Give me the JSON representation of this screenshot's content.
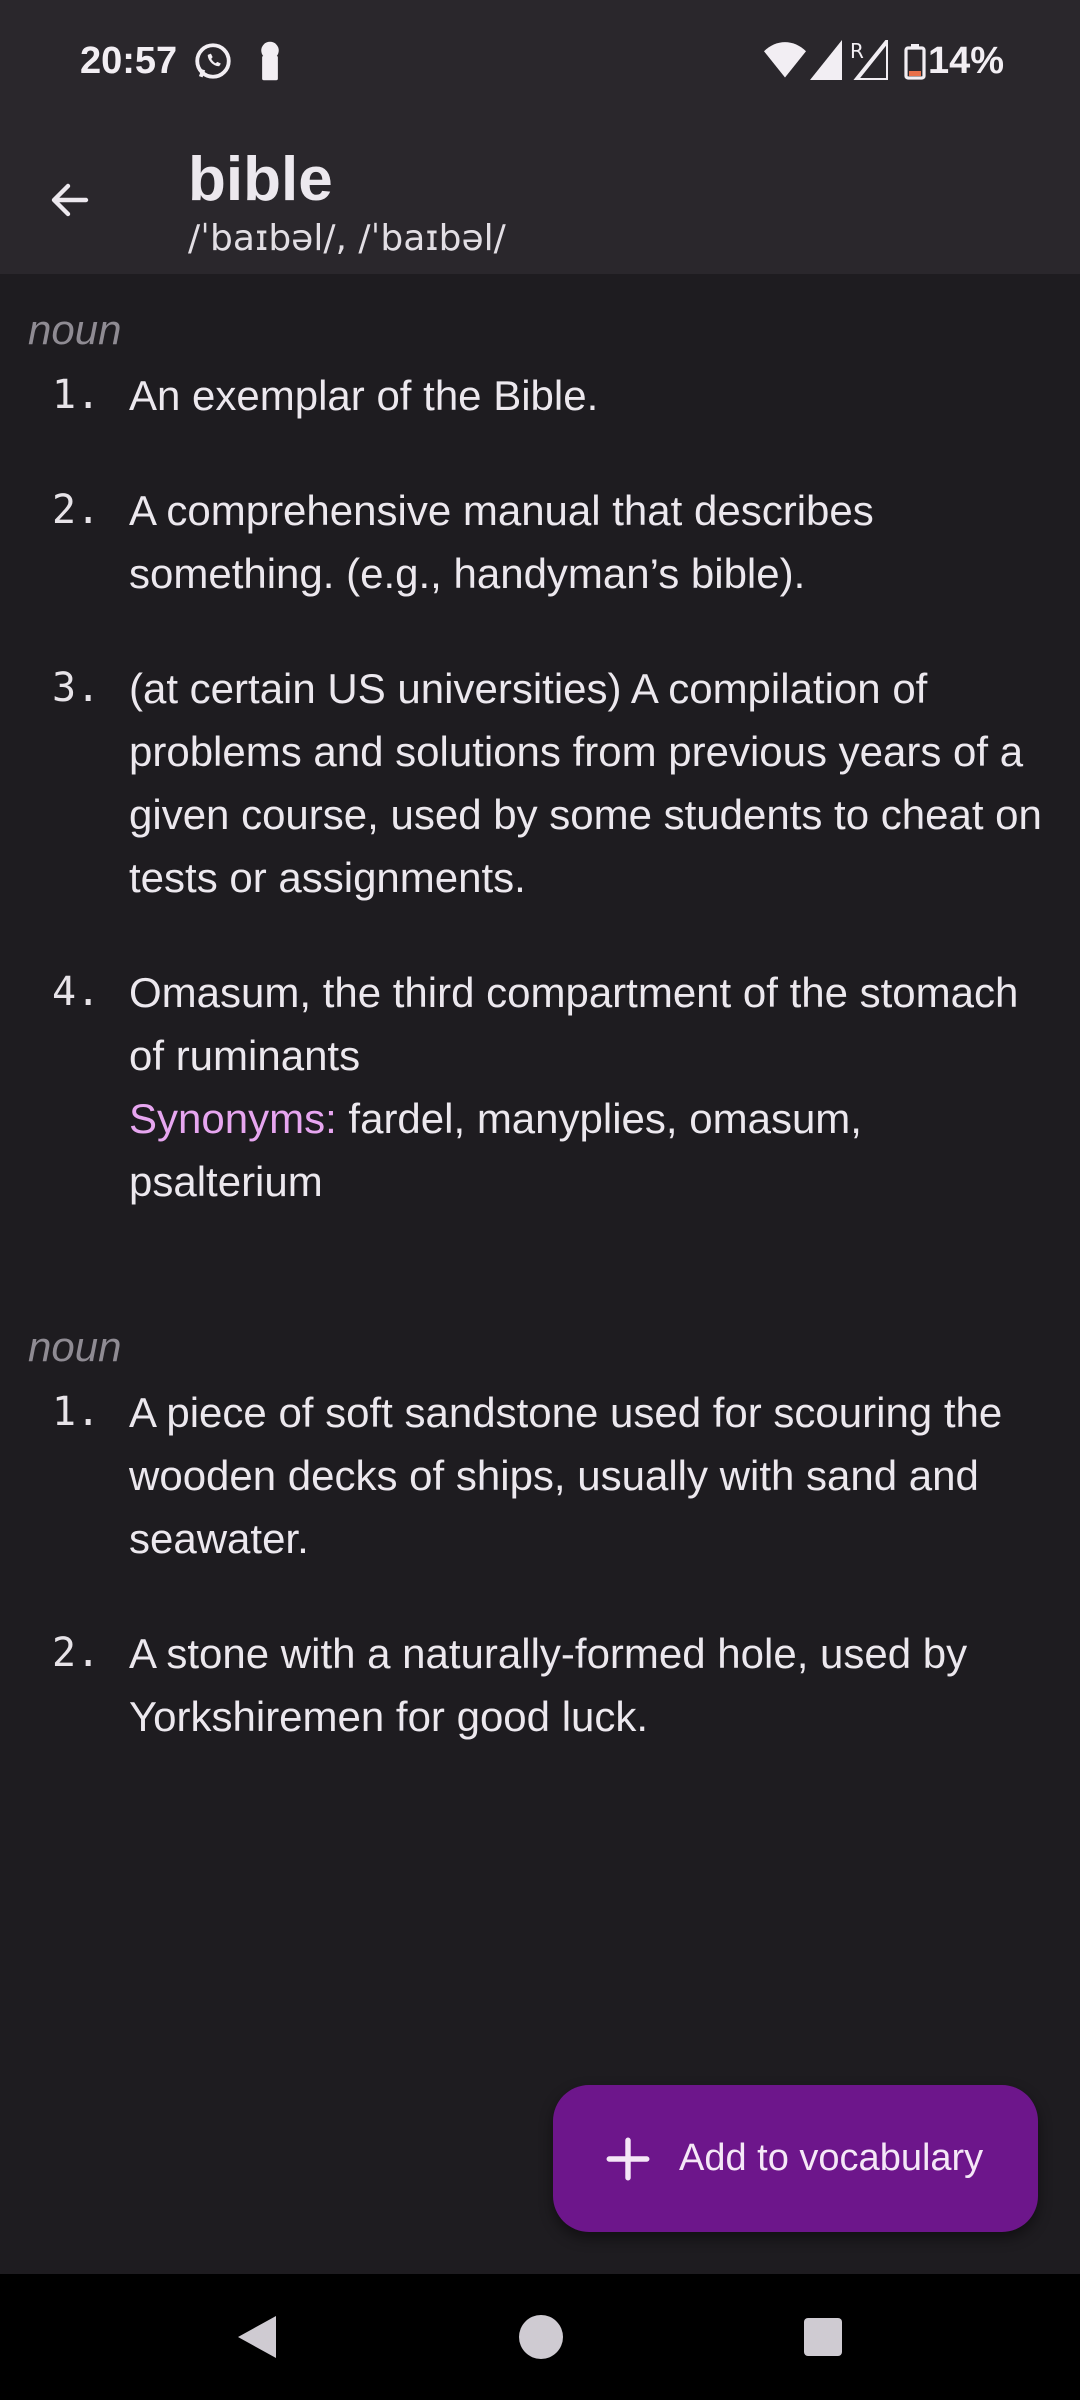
{
  "status_bar": {
    "time": "20:57",
    "battery_percent": "14%",
    "icons": [
      "whatsapp-icon",
      "keyhole-icon",
      "wifi-icon",
      "signal-icon",
      "signal-roaming-icon",
      "battery-low-icon"
    ]
  },
  "app_bar": {
    "back_icon": "arrow-left-icon",
    "word": "bible",
    "pronunciation": "/ˈbaɪbəl/, /ˈbaɪbəl/"
  },
  "sections": [
    {
      "part_of_speech": "noun",
      "definitions": [
        {
          "number": "1.",
          "text": "An exemplar of the Bible."
        },
        {
          "number": "2.",
          "text": "A comprehensive manual that describes something. (e.g., handyman’s bible)."
        },
        {
          "number": "3.",
          "text": "(at certain US universities) A compilation of problems and solutions from previous years of a given course, used by some students to cheat on tests or assignments."
        },
        {
          "number": "4.",
          "text": "Omasum, the third compartment of the stomach of ruminants",
          "synonyms_label": "Synonyms:",
          "synonyms": " fardel, manyplies, omasum, psalterium"
        }
      ]
    },
    {
      "part_of_speech": "noun",
      "definitions": [
        {
          "number": "1.",
          "text": "A piece of soft sandstone used for scouring the wooden decks of ships, usually with sand and seawater."
        },
        {
          "number": "2.",
          "text": "A stone with a naturally-formed hole, used by Yorkshiremen for good luck."
        }
      ]
    }
  ],
  "fab": {
    "icon": "plus-icon",
    "label": "Add to vocabulary",
    "color": "#6d168b"
  },
  "nav_bar": {
    "icons": [
      "nav-back-icon",
      "nav-home-icon",
      "nav-recents-icon"
    ]
  },
  "colors": {
    "background": "#1e1c20",
    "app_bar": "#2a272c",
    "synonyms_accent": "#e7a6f0",
    "part_of_speech": "#8f8b93"
  }
}
